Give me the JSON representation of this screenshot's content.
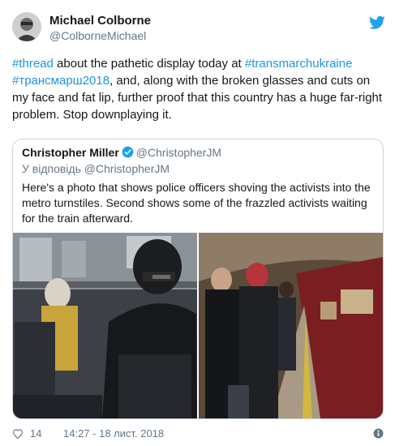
{
  "author": {
    "name": "Michael Colborne",
    "handle": "@ColborneMichael",
    "avatar_icon": "user-avatar",
    "brand_icon": "twitter-bird-icon"
  },
  "tweet": {
    "segments": [
      {
        "text": "#thread",
        "type": "hashtag"
      },
      {
        "text": " about the pathetic display today at ",
        "type": "text"
      },
      {
        "text": "#transmarchukraine",
        "type": "hashtag"
      },
      {
        "text": " ",
        "type": "text"
      },
      {
        "text": "#трансмарш2018",
        "type": "hashtag"
      },
      {
        "text": ", and, along with the broken glasses and cuts on my face and fat lip, further proof that this country has a huge far-right problem. Stop downplaying it.",
        "type": "text"
      }
    ]
  },
  "quoted": {
    "name": "Christopher Miller",
    "handle": "@ChristopherJM",
    "reply_prefix": "У відповідь",
    "reply_handle": "@ChristopherJM",
    "text": "Here's a photo that shows police officers shoving the activists into the metro turnstiles. Second shows some of the frazzled activists waiting for the train afterward.",
    "photos": [
      {
        "label": "police-turnstiles-photo"
      },
      {
        "label": "metro-platform-photo"
      }
    ]
  },
  "footer": {
    "likes": "14",
    "timestamp": "14:27 - 18 лист. 2018"
  },
  "colors": {
    "link": "#1b95e0",
    "text": "#14171a",
    "muted": "#657786",
    "border": "#ccd6dd",
    "twitter_blue": "#1da1f2"
  }
}
